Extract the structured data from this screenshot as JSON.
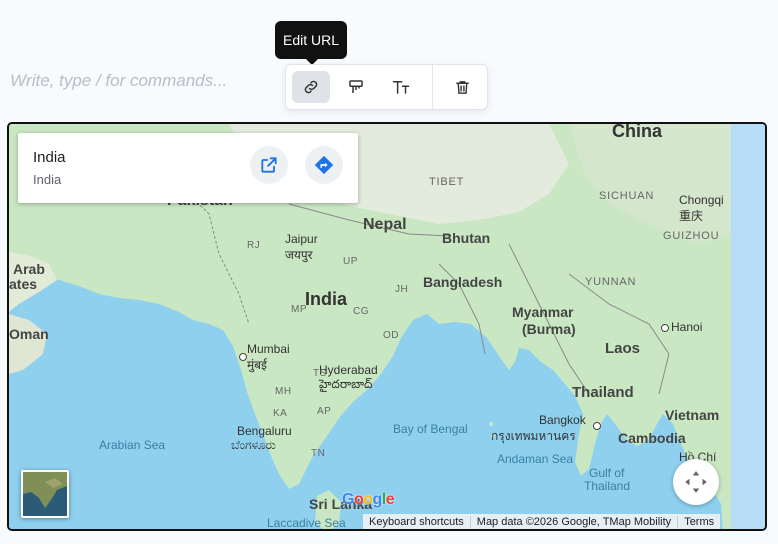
{
  "tooltip": {
    "text": "Edit URL"
  },
  "editor": {
    "placeholder": "Write, type / for commands..."
  },
  "toolbar": {
    "buttons": [
      {
        "icon": "link-icon",
        "label": "Edit URL",
        "active": true
      },
      {
        "icon": "style-icon"
      },
      {
        "icon": "text-size-icon"
      },
      {
        "icon": "trash-icon"
      }
    ]
  },
  "map": {
    "info_card": {
      "title": "India",
      "subtitle": "India"
    },
    "labels": {
      "china": "China",
      "tibet": "TIBET",
      "sichuan": "SICHUAN",
      "chongqing": "Chongqi",
      "chongqing_local": "重庆",
      "guizhou": "GUIZHOU",
      "yunnan": "YUNNAN",
      "pakistan": "Pakistan",
      "nepal": "Nepal",
      "bhutan": "Bhutan",
      "rj": "RJ",
      "jaipur": "Jaipur",
      "jaipur_local": "जयपुर",
      "up": "UP",
      "india": "India",
      "jh": "JH",
      "bangladesh": "Bangladesh",
      "mp": "MP",
      "cg": "CG",
      "od": "OD",
      "arab": "Arab",
      "ates": "ates",
      "oman": "Oman",
      "myanmar": "Myanmar",
      "burma": "(Burma)",
      "hanoi": "Hanoi",
      "mumbai": "Mumbai",
      "mumbai_local": "मुंबई",
      "hyderabad": "Hyderabad",
      "hyderabad_local": "హైదరాబాద్",
      "laos": "Laos",
      "mh": "MH",
      "ts": "TS",
      "thailand": "Thailand",
      "ka": "KA",
      "ap": "AP",
      "bengaluru": "Bengaluru",
      "bengaluru_local": "ಬೆಂಗಳೂರು",
      "bay_of_bengal": "Bay of Bengal",
      "bangkok": "Bangkok",
      "bangkok_local": "กรุงเทพมหานคร",
      "vietnam": "Vietnam",
      "arabian_sea": "Arabian Sea",
      "tn": "TN",
      "cambodia": "Cambodia",
      "andaman_sea": "Andaman Sea",
      "ho_chi": "Hồ Chí",
      "gulf_of": "Gulf of",
      "thailand_gulf": "Thailand",
      "sri_lanka": "Sri Lanka",
      "laccadive_sea": "Laccadive Sea"
    },
    "attribution": {
      "shortcuts": "Keyboard shortcuts",
      "map_data": "Map data ©2026 Google, TMap Mobility",
      "terms": "Terms"
    },
    "colors": {
      "water": "#aadaff",
      "land": "#c9e7c3",
      "highland": "#dfe9d6",
      "google_blue": "#4285f4",
      "google_red": "#ea4335",
      "google_yellow": "#fbbc05",
      "google_green": "#34a853"
    }
  }
}
